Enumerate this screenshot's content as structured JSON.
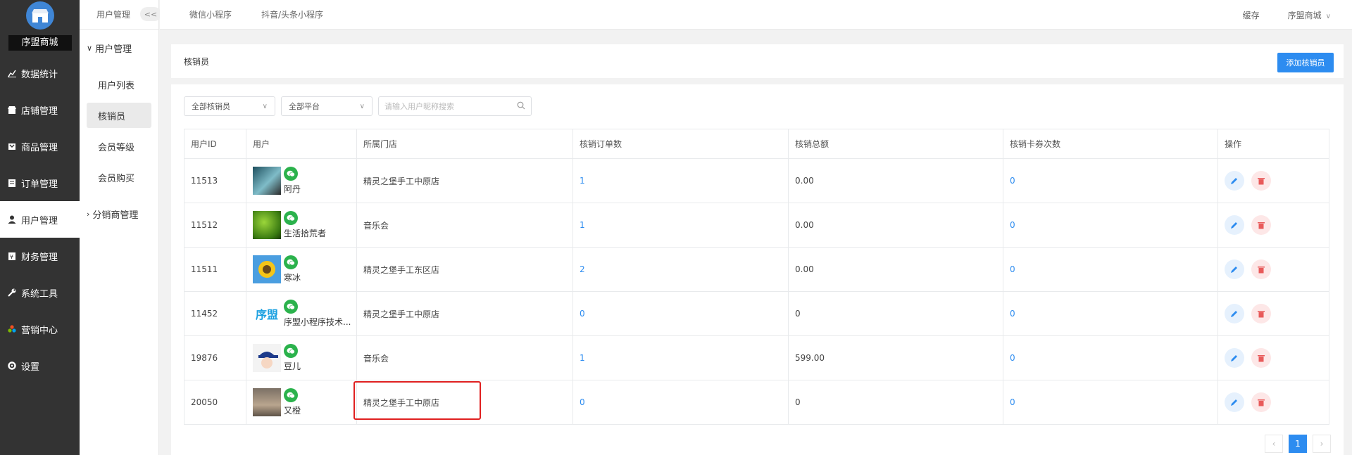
{
  "sidebar": {
    "brand": "序盟商城",
    "items": [
      {
        "label": "数据统计",
        "icon": "chart-icon"
      },
      {
        "label": "店铺管理",
        "icon": "store-icon"
      },
      {
        "label": "商品管理",
        "icon": "goods-icon"
      },
      {
        "label": "订单管理",
        "icon": "order-icon"
      },
      {
        "label": "用户管理",
        "icon": "user-icon"
      },
      {
        "label": "财务管理",
        "icon": "finance-icon"
      },
      {
        "label": "系统工具",
        "icon": "wrench-icon"
      },
      {
        "label": "营销中心",
        "icon": "marketing-icon"
      },
      {
        "label": "设置",
        "icon": "gear-icon"
      }
    ]
  },
  "submenu": {
    "header": "用户管理",
    "collapse": "<<",
    "group1": "用户管理",
    "items": [
      "用户列表",
      "核销员",
      "会员等级",
      "会员购买"
    ],
    "group2": "分销商管理"
  },
  "topbar": {
    "tabs": [
      "微信小程序",
      "抖音/头条小程序"
    ],
    "cache": "缓存",
    "account": "序盟商城"
  },
  "header": {
    "title": "核销员",
    "add_button": "添加核销员"
  },
  "filters": {
    "select1": "全部核销员",
    "select2": "全部平台",
    "search_placeholder": "请输入用户昵称搜索"
  },
  "table": {
    "columns": [
      "用户ID",
      "用户",
      "所属门店",
      "核销订单数",
      "核销总额",
      "核销卡券次数",
      "操作"
    ],
    "rows": [
      {
        "id": "11513",
        "name": "阿丹",
        "store": "精灵之堡手工中原店",
        "orders": "1",
        "total": "0.00",
        "coupons": "0"
      },
      {
        "id": "11512",
        "name": "生活拾荒者",
        "store": "音乐会",
        "orders": "1",
        "total": "0.00",
        "coupons": "0"
      },
      {
        "id": "11511",
        "name": "寒冰",
        "store": "精灵之堡手工东区店",
        "orders": "2",
        "total": "0.00",
        "coupons": "0"
      },
      {
        "id": "11452",
        "name": "序盟小程序技术...",
        "store": "精灵之堡手工中原店",
        "orders": "0",
        "total": "0",
        "coupons": "0"
      },
      {
        "id": "19876",
        "name": "豆儿",
        "store": "音乐会",
        "orders": "1",
        "total": "599.00",
        "coupons": "0"
      },
      {
        "id": "20050",
        "name": "又橙",
        "store": "精灵之堡手工中原店",
        "orders": "0",
        "total": "0",
        "coupons": "0"
      }
    ]
  },
  "avatar_text": "序盟",
  "pagination": {
    "prev": "‹",
    "current": "1",
    "next": "›"
  },
  "colors": {
    "primary": "#2d8cf0",
    "sidebar": "#333333",
    "wechat": "#2bb24c",
    "danger": "#e02020"
  }
}
